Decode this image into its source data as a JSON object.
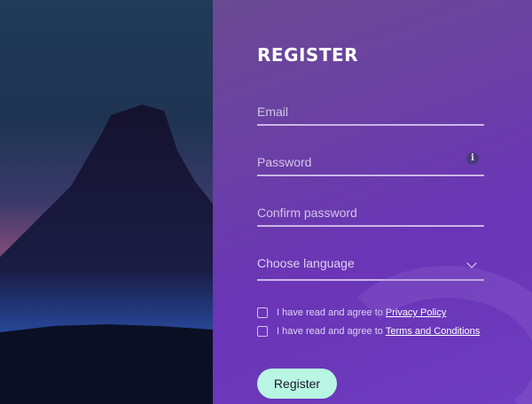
{
  "form": {
    "title": "REGISTER",
    "email_placeholder": "Email",
    "password_placeholder": "Password",
    "confirm_placeholder": "Confirm password",
    "language_label": "Choose language",
    "privacy_prefix": "I have read and agree to",
    "privacy_link": "Privacy Policy",
    "terms_prefix": "I have read and agree to",
    "terms_link": "Terms and Conditions",
    "register_label": "Register",
    "info_glyph": "i"
  },
  "colors": {
    "accent_button": "#b8f5e2",
    "panel_purple": "#6a35b6"
  },
  "icons": {
    "password_info": "info-icon",
    "language_dropdown": "chevron-down-icon"
  }
}
